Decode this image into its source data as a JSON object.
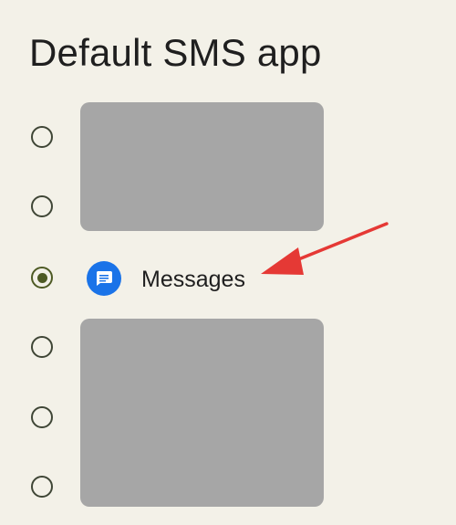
{
  "page": {
    "title": "Default SMS app"
  },
  "options": [
    {
      "label": "",
      "selected": false,
      "redacted": true
    },
    {
      "label": "",
      "selected": false,
      "redacted": true
    },
    {
      "label": "Messages",
      "selected": true,
      "redacted": false,
      "icon": "messages-app-icon"
    },
    {
      "label": "",
      "selected": false,
      "redacted": true
    },
    {
      "label": "",
      "selected": false,
      "redacted": true
    },
    {
      "label": "",
      "selected": false,
      "redacted": true
    }
  ],
  "annotation": {
    "type": "arrow",
    "color": "#e53935",
    "points_to": "Messages"
  },
  "colors": {
    "background": "#f3f1e8",
    "radio_selected": "#4d5a24",
    "redaction": "#a6a6a6",
    "messages_icon": "#1a73e8"
  }
}
